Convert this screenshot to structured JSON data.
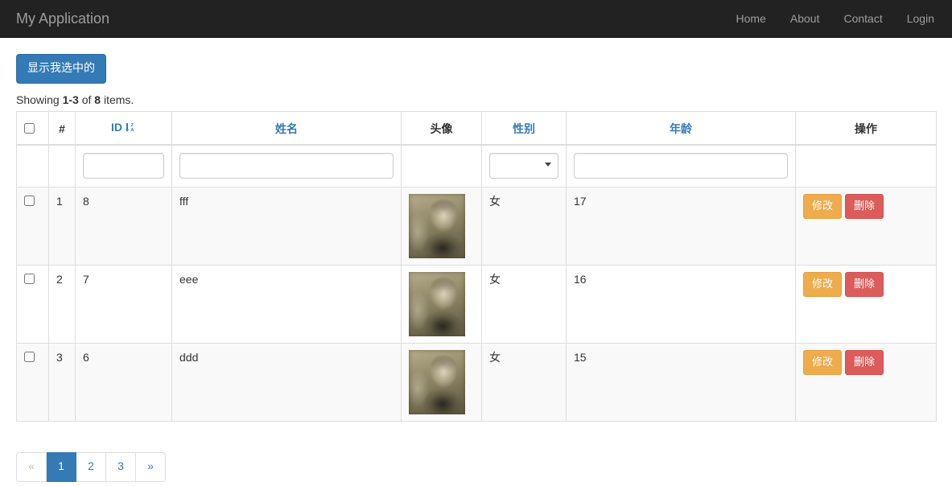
{
  "navbar": {
    "brand": "My Application",
    "links": [
      {
        "label": "Home"
      },
      {
        "label": "About"
      },
      {
        "label": "Contact"
      },
      {
        "label": "Login"
      }
    ]
  },
  "toolbar": {
    "show_selected_label": "显示我选中的"
  },
  "summary": {
    "prefix": "Showing ",
    "range": "1-3",
    "middle": " of ",
    "total": "8",
    "suffix": " items."
  },
  "grid": {
    "columns": [
      {
        "key": "check",
        "label": "",
        "sortable": false,
        "link": false
      },
      {
        "key": "num",
        "label": "#",
        "sortable": false,
        "link": false
      },
      {
        "key": "id",
        "label": "ID",
        "sortable": true,
        "link": true,
        "sort_icon": "sort-amount-desc-icon"
      },
      {
        "key": "name",
        "label": "姓名",
        "sortable": false,
        "link": true
      },
      {
        "key": "avatar",
        "label": "头像",
        "sortable": false,
        "link": false
      },
      {
        "key": "sex",
        "label": "性别",
        "sortable": false,
        "link": true
      },
      {
        "key": "age",
        "label": "年龄",
        "sortable": false,
        "link": true
      },
      {
        "key": "op",
        "label": "操作",
        "sortable": false,
        "link": false
      }
    ],
    "filters": {
      "id_value": "",
      "id_placeholder": "",
      "name_value": "",
      "name_placeholder": "",
      "sex_selected": "",
      "sex_options": [
        ""
      ],
      "age_value": "",
      "age_placeholder": ""
    },
    "rows": [
      {
        "checked": false,
        "num": "1",
        "id": "8",
        "name": "fff",
        "avatar": "avatar-thumbnail",
        "sex": "女",
        "age": "17",
        "edit_label": "修改",
        "delete_label": "删除"
      },
      {
        "checked": false,
        "num": "2",
        "id": "7",
        "name": "eee",
        "avatar": "avatar-thumbnail",
        "sex": "女",
        "age": "16",
        "edit_label": "修改",
        "delete_label": "删除"
      },
      {
        "checked": false,
        "num": "3",
        "id": "6",
        "name": "ddd",
        "avatar": "avatar-thumbnail",
        "sex": "女",
        "age": "15",
        "edit_label": "修改",
        "delete_label": "删除"
      }
    ]
  },
  "pagination": {
    "items": [
      {
        "label": "«",
        "state": "disabled"
      },
      {
        "label": "1",
        "state": "active"
      },
      {
        "label": "2",
        "state": "normal"
      },
      {
        "label": "3",
        "state": "normal"
      },
      {
        "label": "»",
        "state": "normal"
      }
    ]
  },
  "colors": {
    "navbar_bg": "#222222",
    "primary": "#337ab7",
    "warning": "#eeac4d",
    "danger": "#dc5c5c",
    "link": "#337ab7"
  }
}
